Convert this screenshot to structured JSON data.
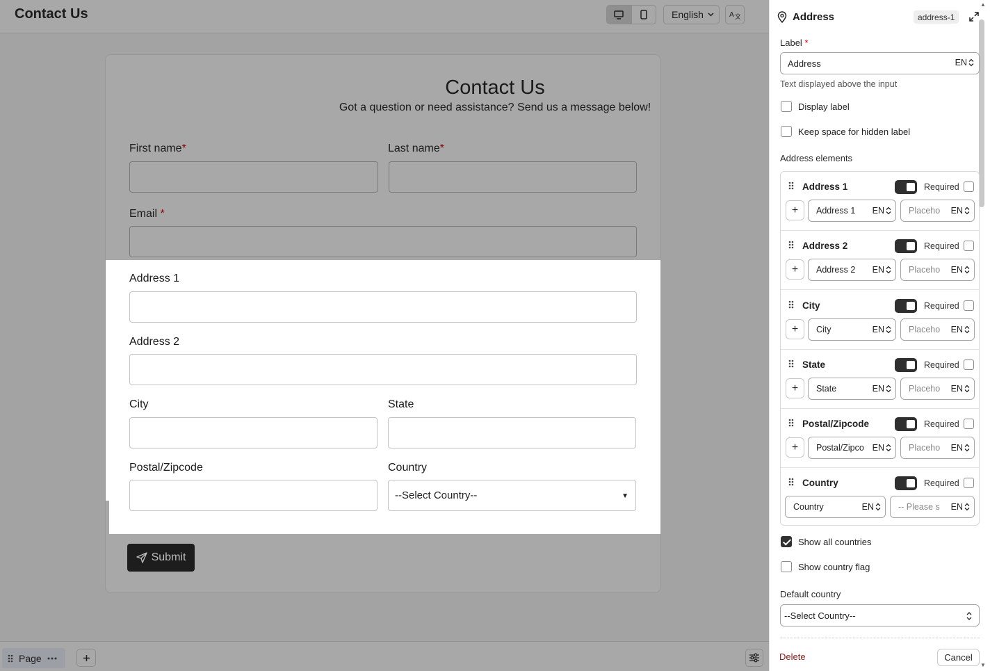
{
  "app": {
    "title": "Contact Us"
  },
  "toolbar": {
    "device_modes": [
      "desktop-icon",
      "mobile-icon"
    ],
    "active_device": "desktop",
    "language": "English"
  },
  "form": {
    "title": "Contact Us",
    "subtitle": "Got a question or need assistance? Send us a message below!",
    "first_name_label": "First name",
    "last_name_label": "Last name",
    "email_label": "Email ",
    "required_mark": "*",
    "address1_label": "Address 1",
    "address2_label": "Address 2",
    "city_label": "City",
    "state_label": "State",
    "postal_label": "Postal/Zipcode",
    "country_label": "Country",
    "country_select_value": "--Select Country--",
    "submit_label": "Submit"
  },
  "bottombar": {
    "page_label": "Page"
  },
  "panel": {
    "title": "Address",
    "id_badge": "address-1",
    "label_field_label": "Label",
    "label_required_mark": "*",
    "label_value": "Address",
    "lang_code": "EN",
    "label_help": "Text displayed above the input",
    "display_label": "Display label",
    "display_label_checked": false,
    "keep_space": "Keep space for hidden label",
    "keep_space_checked": false,
    "address_elements_title": "Address elements",
    "required_text": "Required",
    "elements": [
      {
        "name": "Address 1",
        "label_value": "Address 1",
        "placeholder": "Placeho",
        "enabled": true,
        "required": false
      },
      {
        "name": "Address 2",
        "label_value": "Address 2",
        "placeholder": "Placeho",
        "enabled": true,
        "required": false
      },
      {
        "name": "City",
        "label_value": "City",
        "placeholder": "Placeho",
        "enabled": true,
        "required": false
      },
      {
        "name": "State",
        "label_value": "State",
        "placeholder": "Placeho",
        "enabled": true,
        "required": false
      },
      {
        "name": "Postal/Zipcode",
        "label_value": "Postal/Zipco",
        "placeholder": "Placeho",
        "enabled": true,
        "required": false
      },
      {
        "name": "Country",
        "label_value": "Country",
        "placeholder": "-- Please s",
        "enabled": true,
        "required": false
      }
    ],
    "show_all_countries": "Show all countries",
    "show_all_countries_checked": true,
    "show_flag": "Show country flag",
    "show_flag_checked": false,
    "default_country_label": "Default country",
    "default_country_value": "--Select Country--",
    "delete_label": "Delete",
    "cancel_label": "Cancel"
  },
  "colors": {
    "accent_dark": "#2f2f2f",
    "delete_red": "#8b1a1a",
    "required_red": "#8b0000"
  }
}
